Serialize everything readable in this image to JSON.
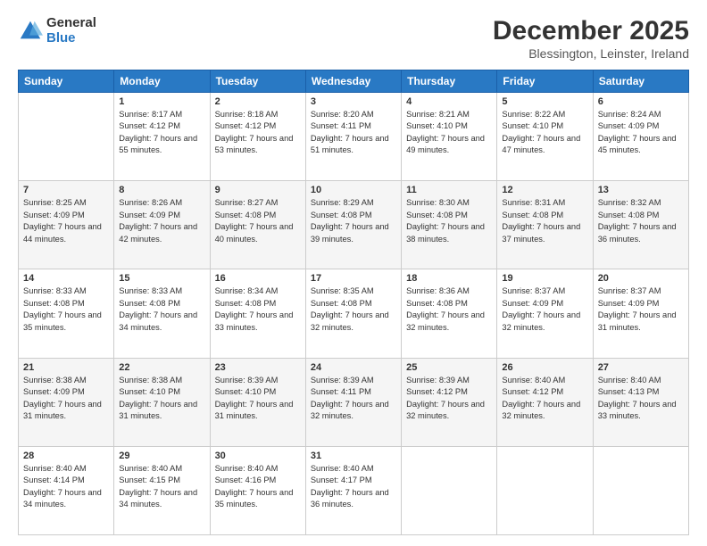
{
  "logo": {
    "general": "General",
    "blue": "Blue"
  },
  "title": "December 2025",
  "subtitle": "Blessington, Leinster, Ireland",
  "days_header": [
    "Sunday",
    "Monday",
    "Tuesday",
    "Wednesday",
    "Thursday",
    "Friday",
    "Saturday"
  ],
  "weeks": [
    [
      {
        "day": "",
        "sunrise": "",
        "sunset": "",
        "daylight": ""
      },
      {
        "day": "1",
        "sunrise": "Sunrise: 8:17 AM",
        "sunset": "Sunset: 4:12 PM",
        "daylight": "Daylight: 7 hours and 55 minutes."
      },
      {
        "day": "2",
        "sunrise": "Sunrise: 8:18 AM",
        "sunset": "Sunset: 4:12 PM",
        "daylight": "Daylight: 7 hours and 53 minutes."
      },
      {
        "day": "3",
        "sunrise": "Sunrise: 8:20 AM",
        "sunset": "Sunset: 4:11 PM",
        "daylight": "Daylight: 7 hours and 51 minutes."
      },
      {
        "day": "4",
        "sunrise": "Sunrise: 8:21 AM",
        "sunset": "Sunset: 4:10 PM",
        "daylight": "Daylight: 7 hours and 49 minutes."
      },
      {
        "day": "5",
        "sunrise": "Sunrise: 8:22 AM",
        "sunset": "Sunset: 4:10 PM",
        "daylight": "Daylight: 7 hours and 47 minutes."
      },
      {
        "day": "6",
        "sunrise": "Sunrise: 8:24 AM",
        "sunset": "Sunset: 4:09 PM",
        "daylight": "Daylight: 7 hours and 45 minutes."
      }
    ],
    [
      {
        "day": "7",
        "sunrise": "Sunrise: 8:25 AM",
        "sunset": "Sunset: 4:09 PM",
        "daylight": "Daylight: 7 hours and 44 minutes."
      },
      {
        "day": "8",
        "sunrise": "Sunrise: 8:26 AM",
        "sunset": "Sunset: 4:09 PM",
        "daylight": "Daylight: 7 hours and 42 minutes."
      },
      {
        "day": "9",
        "sunrise": "Sunrise: 8:27 AM",
        "sunset": "Sunset: 4:08 PM",
        "daylight": "Daylight: 7 hours and 40 minutes."
      },
      {
        "day": "10",
        "sunrise": "Sunrise: 8:29 AM",
        "sunset": "Sunset: 4:08 PM",
        "daylight": "Daylight: 7 hours and 39 minutes."
      },
      {
        "day": "11",
        "sunrise": "Sunrise: 8:30 AM",
        "sunset": "Sunset: 4:08 PM",
        "daylight": "Daylight: 7 hours and 38 minutes."
      },
      {
        "day": "12",
        "sunrise": "Sunrise: 8:31 AM",
        "sunset": "Sunset: 4:08 PM",
        "daylight": "Daylight: 7 hours and 37 minutes."
      },
      {
        "day": "13",
        "sunrise": "Sunrise: 8:32 AM",
        "sunset": "Sunset: 4:08 PM",
        "daylight": "Daylight: 7 hours and 36 minutes."
      }
    ],
    [
      {
        "day": "14",
        "sunrise": "Sunrise: 8:33 AM",
        "sunset": "Sunset: 4:08 PM",
        "daylight": "Daylight: 7 hours and 35 minutes."
      },
      {
        "day": "15",
        "sunrise": "Sunrise: 8:33 AM",
        "sunset": "Sunset: 4:08 PM",
        "daylight": "Daylight: 7 hours and 34 minutes."
      },
      {
        "day": "16",
        "sunrise": "Sunrise: 8:34 AM",
        "sunset": "Sunset: 4:08 PM",
        "daylight": "Daylight: 7 hours and 33 minutes."
      },
      {
        "day": "17",
        "sunrise": "Sunrise: 8:35 AM",
        "sunset": "Sunset: 4:08 PM",
        "daylight": "Daylight: 7 hours and 32 minutes."
      },
      {
        "day": "18",
        "sunrise": "Sunrise: 8:36 AM",
        "sunset": "Sunset: 4:08 PM",
        "daylight": "Daylight: 7 hours and 32 minutes."
      },
      {
        "day": "19",
        "sunrise": "Sunrise: 8:37 AM",
        "sunset": "Sunset: 4:09 PM",
        "daylight": "Daylight: 7 hours and 32 minutes."
      },
      {
        "day": "20",
        "sunrise": "Sunrise: 8:37 AM",
        "sunset": "Sunset: 4:09 PM",
        "daylight": "Daylight: 7 hours and 31 minutes."
      }
    ],
    [
      {
        "day": "21",
        "sunrise": "Sunrise: 8:38 AM",
        "sunset": "Sunset: 4:09 PM",
        "daylight": "Daylight: 7 hours and 31 minutes."
      },
      {
        "day": "22",
        "sunrise": "Sunrise: 8:38 AM",
        "sunset": "Sunset: 4:10 PM",
        "daylight": "Daylight: 7 hours and 31 minutes."
      },
      {
        "day": "23",
        "sunrise": "Sunrise: 8:39 AM",
        "sunset": "Sunset: 4:10 PM",
        "daylight": "Daylight: 7 hours and 31 minutes."
      },
      {
        "day": "24",
        "sunrise": "Sunrise: 8:39 AM",
        "sunset": "Sunset: 4:11 PM",
        "daylight": "Daylight: 7 hours and 32 minutes."
      },
      {
        "day": "25",
        "sunrise": "Sunrise: 8:39 AM",
        "sunset": "Sunset: 4:12 PM",
        "daylight": "Daylight: 7 hours and 32 minutes."
      },
      {
        "day": "26",
        "sunrise": "Sunrise: 8:40 AM",
        "sunset": "Sunset: 4:12 PM",
        "daylight": "Daylight: 7 hours and 32 minutes."
      },
      {
        "day": "27",
        "sunrise": "Sunrise: 8:40 AM",
        "sunset": "Sunset: 4:13 PM",
        "daylight": "Daylight: 7 hours and 33 minutes."
      }
    ],
    [
      {
        "day": "28",
        "sunrise": "Sunrise: 8:40 AM",
        "sunset": "Sunset: 4:14 PM",
        "daylight": "Daylight: 7 hours and 34 minutes."
      },
      {
        "day": "29",
        "sunrise": "Sunrise: 8:40 AM",
        "sunset": "Sunset: 4:15 PM",
        "daylight": "Daylight: 7 hours and 34 minutes."
      },
      {
        "day": "30",
        "sunrise": "Sunrise: 8:40 AM",
        "sunset": "Sunset: 4:16 PM",
        "daylight": "Daylight: 7 hours and 35 minutes."
      },
      {
        "day": "31",
        "sunrise": "Sunrise: 8:40 AM",
        "sunset": "Sunset: 4:17 PM",
        "daylight": "Daylight: 7 hours and 36 minutes."
      },
      {
        "day": "",
        "sunrise": "",
        "sunset": "",
        "daylight": ""
      },
      {
        "day": "",
        "sunrise": "",
        "sunset": "",
        "daylight": ""
      },
      {
        "day": "",
        "sunrise": "",
        "sunset": "",
        "daylight": ""
      }
    ]
  ]
}
